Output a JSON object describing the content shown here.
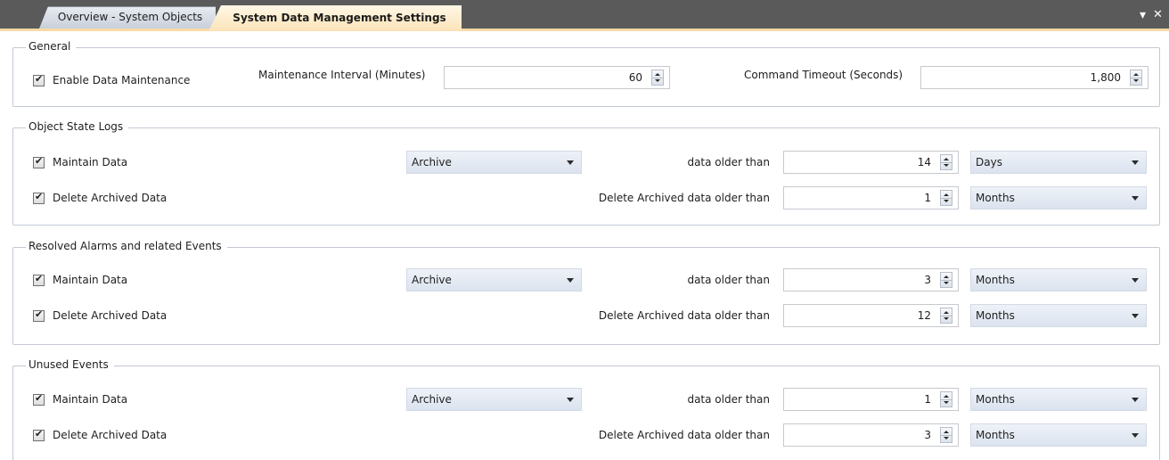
{
  "tabs": [
    {
      "label": "Overview - System Objects"
    },
    {
      "label": "System Data Management Settings"
    }
  ],
  "window_controls": {
    "dropdown": "▾",
    "close": "✕"
  },
  "general": {
    "title": "General",
    "enable_label": "Enable Data Maintenance",
    "interval_label": "Maintenance Interval (Minutes)",
    "interval_value": "60",
    "timeout_label": "Command Timeout (Seconds)",
    "timeout_value": "1,800"
  },
  "groups": [
    {
      "title": "Object State Logs",
      "maintain_label": "Maintain Data",
      "action": "Archive",
      "older_label": "data older than",
      "older_value": "14",
      "older_unit": "Days",
      "delete_label": "Delete Archived Data",
      "delete_older_label": "Delete Archived data older than",
      "delete_value": "1",
      "delete_unit": "Months"
    },
    {
      "title": "Resolved Alarms and related Events",
      "maintain_label": "Maintain Data",
      "action": "Archive",
      "older_label": "data older than",
      "older_value": "3",
      "older_unit": "Months",
      "delete_label": "Delete Archived Data",
      "delete_older_label": "Delete Archived data older than",
      "delete_value": "12",
      "delete_unit": "Months"
    },
    {
      "title": "Unused Events",
      "maintain_label": "Maintain Data",
      "action": "Archive",
      "older_label": "data older than",
      "older_value": "1",
      "older_unit": "Months",
      "delete_label": "Delete Archived Data",
      "delete_older_label": "Delete Archived data older than",
      "delete_value": "3",
      "delete_unit": "Months"
    }
  ]
}
